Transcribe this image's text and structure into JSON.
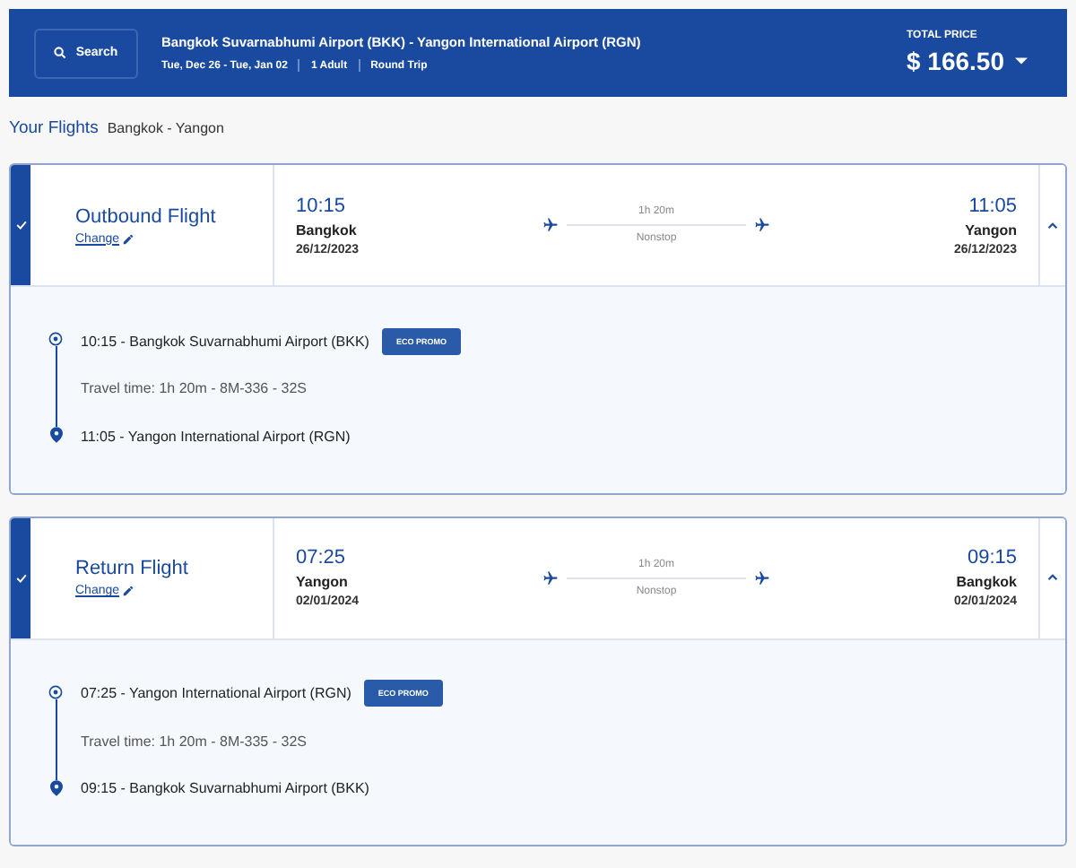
{
  "header": {
    "search_button": "Search",
    "route": "Bangkok Suvarnabhumi Airport (BKK) - Yangon International Airport (RGN)",
    "dates": "Tue, Dec 26 - Tue, Jan 02",
    "passengers": "1 Adult",
    "trip_type": "Round Trip",
    "total_label": "TOTAL PRICE",
    "total_price": "$ 166.50"
  },
  "your_flights": {
    "title": "Your Flights",
    "route": "Bangkok - Yangon"
  },
  "flights": [
    {
      "title": "Outbound Flight",
      "change_link": "Change",
      "selected": true,
      "expanded": true,
      "depart_time": "10:15",
      "depart_city": "Bangkok",
      "depart_date": "26/12/2023",
      "duration": "1h 20m",
      "stops": "Nonstop",
      "arrive_time": "11:05",
      "arrive_city": "Yangon",
      "arrive_date": "26/12/2023",
      "detail_depart": "10:15 - Bangkok Suvarnabhumi Airport (BKK)",
      "fare_badge": "ECO PROMO",
      "travel_info": "Travel time: 1h 20m - 8M-336 - 32S",
      "detail_arrive": "11:05 - Yangon International Airport (RGN)"
    },
    {
      "title": "Return Flight",
      "change_link": "Change",
      "selected": true,
      "expanded": true,
      "depart_time": "07:25",
      "depart_city": "Yangon",
      "depart_date": "02/01/2024",
      "duration": "1h 20m",
      "stops": "Nonstop",
      "arrive_time": "09:15",
      "arrive_city": "Bangkok",
      "arrive_date": "02/01/2024",
      "detail_depart": "07:25 - Yangon International Airport (RGN)",
      "fare_badge": "ECO PROMO",
      "travel_info": "Travel time: 1h 20m - 8M-335 - 32S",
      "detail_arrive": "09:15 - Bangkok Suvarnabhumi Airport (BKK)"
    }
  ]
}
